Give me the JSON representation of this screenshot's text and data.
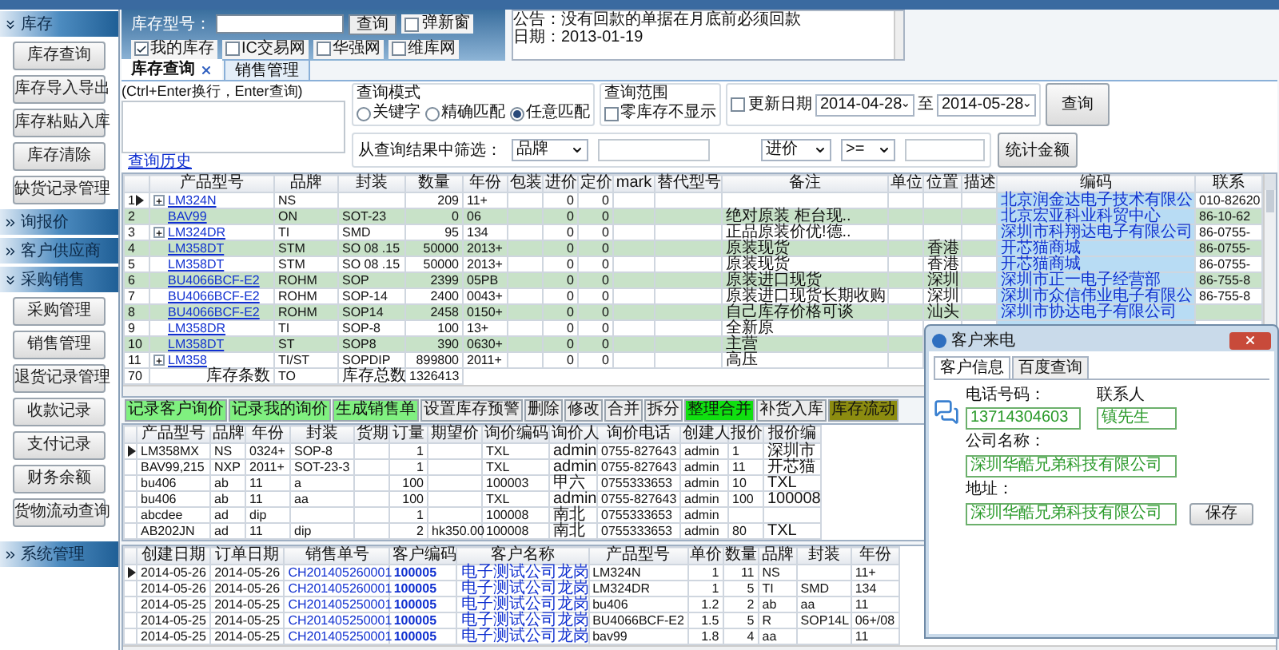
{
  "sidebar": {
    "sections": [
      {
        "label": "库存",
        "expanded": true,
        "items": [
          "库存查询",
          "库存导入导出",
          "库存粘贴入库",
          "库存清除",
          "缺货记录管理"
        ]
      },
      {
        "label": "询报价",
        "expanded": false
      },
      {
        "label": "客户供应商",
        "expanded": false
      },
      {
        "label": "采购销售",
        "expanded": true,
        "items": [
          "采购管理",
          "销售管理",
          "退货记录管理",
          "收款记录",
          "支付记录",
          "财务余额",
          "货物流动查询"
        ]
      },
      {
        "label": "系统管理",
        "expanded": false
      }
    ]
  },
  "header": {
    "model_label": "库存型号：",
    "search_button": "查询",
    "popup": {
      "label": "弹新窗",
      "checked": false
    },
    "sources": [
      {
        "label": "我的库存",
        "checked": true
      },
      {
        "label": "IC交易网",
        "checked": false
      },
      {
        "label": "华强网",
        "checked": false
      },
      {
        "label": "维库网",
        "checked": false
      }
    ],
    "notice": [
      "公告：没有回款的单据在月底前必须回款",
      "日期：2013-01-19"
    ]
  },
  "tabs": [
    {
      "label": "库存查询",
      "selected": true,
      "closable": true
    },
    {
      "label": "销售管理",
      "selected": false,
      "closable": false
    }
  ],
  "query": {
    "hint": "(Ctrl+Enter换行，Enter查询)",
    "history_link": "查询历史",
    "mode": {
      "title": "查询模式",
      "options": [
        {
          "label": "关键字",
          "selected": false
        },
        {
          "label": "精确匹配",
          "selected": false
        },
        {
          "label": "任意匹配",
          "selected": true
        }
      ]
    },
    "range": {
      "title": "查询范围",
      "hide_zero": {
        "label": "零库存不显示",
        "checked": false
      }
    },
    "date_filter": {
      "label": "更新日期",
      "checked": false,
      "from": "2014-04-28",
      "to_label": "至",
      "to": "2014-05-28"
    },
    "search_button": "查询",
    "filter": {
      "label": "从查询结果中筛选：",
      "field": "品牌",
      "price_field": "进价",
      "operator": ">="
    },
    "sum_button": "统计金额"
  },
  "stock_table": {
    "columns": [
      "产品型号",
      "品牌",
      "封装",
      "数量",
      "年份",
      "包装",
      "进价",
      "定价",
      "mark",
      "替代型号",
      "备注",
      "单位",
      "位置",
      "描述",
      "编码",
      "联系"
    ],
    "rows": [
      {
        "num": "1",
        "current": true,
        "expandable": true,
        "highlighted": false,
        "cells": [
          "LM324N",
          "NS",
          null,
          "209",
          "11+",
          null,
          "0",
          "0",
          null,
          null,
          null,
          null,
          null,
          null,
          "北京润金达电子技术有限公",
          "010-82620"
        ]
      },
      {
        "num": "2",
        "current": false,
        "expandable": false,
        "highlighted": true,
        "cells": [
          "BAV99",
          "ON",
          "SOT-23",
          "0",
          "06",
          null,
          "0",
          "0",
          null,
          null,
          "绝对原装 柜台现..",
          null,
          null,
          null,
          "北京宏亚科业科贸中心",
          "86-10-62"
        ]
      },
      {
        "num": "3",
        "current": false,
        "expandable": true,
        "highlighted": false,
        "cells": [
          "LM324DR",
          "TI",
          "SMD",
          "95",
          "134",
          null,
          "0",
          "0",
          null,
          null,
          "正品原装价优!德..",
          null,
          null,
          null,
          "深圳市科翔达电子有限公司",
          "86-0755-"
        ]
      },
      {
        "num": "4",
        "current": false,
        "expandable": false,
        "highlighted": true,
        "cells": [
          "LM358DT",
          "STM",
          "SO 08 .15",
          "50000",
          "2013+",
          null,
          "0",
          "0",
          null,
          null,
          "原装现货",
          null,
          "香港",
          null,
          "开芯猫商城",
          "86-0755-"
        ]
      },
      {
        "num": "5",
        "current": false,
        "expandable": false,
        "highlighted": false,
        "cells": [
          "LM358DT",
          "STM",
          "SO 08 .15",
          "50000",
          "2013+",
          null,
          "0",
          "0",
          null,
          null,
          "原装现货",
          null,
          "香港",
          null,
          "开芯猫商城",
          "86-0755-"
        ]
      },
      {
        "num": "6",
        "current": false,
        "expandable": false,
        "highlighted": true,
        "cells": [
          "BU4066BCF-E2",
          "ROHM",
          "SOP",
          "2399",
          "05PB",
          null,
          "0",
          "0",
          null,
          null,
          "原装进口现货",
          null,
          "深圳",
          null,
          "深圳市正一电子经营部",
          "86-755-8"
        ]
      },
      {
        "num": "7",
        "current": false,
        "expandable": false,
        "highlighted": false,
        "cells": [
          "BU4066BCF-E2",
          "ROHM",
          "SOP-14",
          "2400",
          "0043+",
          null,
          "0",
          "0",
          null,
          null,
          "原装进口现货长期收购",
          null,
          "深圳",
          null,
          "深圳市众信伟业电子有限公",
          "86-755-8"
        ]
      },
      {
        "num": "8",
        "current": false,
        "expandable": false,
        "highlighted": true,
        "cells": [
          "BU4066BCF-E2",
          "ROHM",
          "SOP14",
          "2458",
          "0150+",
          null,
          "0",
          "0",
          null,
          null,
          "自己库存价格可谈",
          null,
          "汕头",
          null,
          "深圳市协达电子有限公司",
          null
        ]
      },
      {
        "num": "9",
        "current": false,
        "expandable": false,
        "highlighted": false,
        "cells": [
          "LM358DR",
          "TI",
          "SOP-8",
          "100",
          "13+",
          null,
          "0",
          "0",
          null,
          null,
          "全新原",
          null,
          null,
          null,
          null,
          null
        ]
      },
      {
        "num": "10",
        "current": false,
        "expandable": false,
        "highlighted": true,
        "cells": [
          "LM358DT",
          "ST",
          "SOP8",
          "390",
          "0630+",
          null,
          "0",
          "0",
          null,
          null,
          "主营",
          null,
          null,
          null,
          null,
          null
        ]
      },
      {
        "num": "11",
        "current": false,
        "expandable": true,
        "highlighted": false,
        "cells": [
          "LM358",
          "TI/ST",
          "SOPDIP",
          "899800",
          "2011+",
          null,
          "0",
          "0",
          null,
          null,
          "高压",
          null,
          null,
          null,
          null,
          null
        ]
      }
    ],
    "footer": {
      "count": "70",
      "count_label": "库存条数",
      "brand": "TO",
      "total_label": "库存总数",
      "total": "1326413"
    }
  },
  "actions": [
    {
      "label": "记录客户询价",
      "color": "#80f080"
    },
    {
      "label": "记录我的询价",
      "color": "#80f080"
    },
    {
      "label": "生成销售单",
      "color": "#80f080"
    },
    {
      "label": "设置库存预警",
      "color": "#ececec"
    },
    {
      "label": "删除",
      "color": "#ececec"
    },
    {
      "label": "修改",
      "color": "#ececec"
    },
    {
      "label": "合并",
      "color": "#ececec"
    },
    {
      "label": "拆分",
      "color": "#ececec"
    },
    {
      "label": "整理合并",
      "color": "#10e010"
    },
    {
      "label": "补货入库",
      "color": "#ececec"
    },
    {
      "label": "库存流动",
      "color": "#8c8c10"
    }
  ],
  "inquiry_table": {
    "columns": [
      "产品型号",
      "品牌",
      "年份",
      "封装",
      "货期",
      "订量",
      "期望价",
      "询价编码",
      "询价人",
      "询价电话",
      "创建人",
      "报价",
      "报价编"
    ],
    "rows": [
      {
        "current": true,
        "cells": [
          "LM358MX",
          "NS",
          "0324+",
          "SOP-8",
          null,
          "1",
          null,
          "TXL",
          "admin",
          "0755-827643",
          "admin",
          "1",
          "深圳市"
        ]
      },
      {
        "current": false,
        "cells": [
          "BAV99,215",
          "NXP",
          "2011+",
          "SOT-23-3",
          null,
          "1",
          null,
          "TXL",
          "admin",
          "0755-827643",
          "admin",
          "11",
          "开芯猫"
        ]
      },
      {
        "current": false,
        "cells": [
          "bu406",
          "ab",
          "11",
          "a",
          null,
          "100",
          null,
          "100003",
          "甲六",
          "0755333653",
          "admin",
          "10",
          "TXL"
        ]
      },
      {
        "current": false,
        "cells": [
          "bu406",
          "ab",
          "11",
          "aa",
          null,
          "100",
          null,
          "TXL",
          "admin",
          "0755-827643",
          "admin",
          "100",
          "100008"
        ]
      },
      {
        "current": false,
        "cells": [
          "abcdee",
          "ad",
          "dip",
          null,
          null,
          "1",
          null,
          "100008",
          "南北",
          "0755333653",
          "admin",
          null,
          null
        ]
      },
      {
        "current": false,
        "cells": [
          "AB202JN",
          "ad",
          "11",
          "dip",
          null,
          "2",
          "hk350.00",
          "100008",
          "南北",
          "0755333653",
          "admin",
          "80",
          "TXL"
        ]
      }
    ]
  },
  "sales_table": {
    "columns": [
      "创建日期",
      "订单日期",
      "销售单号",
      "客户编码",
      "客户名称",
      "产品型号",
      "单价",
      "数量",
      "品牌",
      "封装",
      "年份"
    ],
    "rows": [
      {
        "current": true,
        "cells": [
          "2014-05-26",
          "2014-05-26",
          "CH201405260001",
          "100005",
          "电子测试公司龙岗",
          "LM324N",
          "1",
          "11",
          "NS",
          null,
          "11+"
        ]
      },
      {
        "current": false,
        "cells": [
          "2014-05-26",
          "2014-05-26",
          "CH201405260001",
          "100005",
          "电子测试公司龙岗",
          "LM324DR",
          "1",
          "5",
          "TI",
          "SMD",
          "134"
        ]
      },
      {
        "current": false,
        "cells": [
          "2014-05-25",
          "2014-05-25",
          "CH201405250001",
          "100005",
          "电子测试公司龙岗",
          "bu406",
          "1.2",
          "2",
          "ab",
          "aa",
          "11"
        ]
      },
      {
        "current": false,
        "cells": [
          "2014-05-25",
          "2014-05-25",
          "CH201405250001",
          "100005",
          "电子测试公司龙岗",
          "BU4066BCF-E2",
          "1.5",
          "5",
          "R",
          "SOP14L",
          "06+/08"
        ]
      },
      {
        "current": false,
        "cells": [
          "2014-05-25",
          "2014-05-25",
          "CH201405250001",
          "100005",
          "电子测试公司龙岗",
          "bav99",
          "1.8",
          "4",
          "aa",
          null,
          "11"
        ]
      }
    ]
  },
  "dialog": {
    "title": "客户来电",
    "tabs": [
      {
        "label": "客户信息",
        "selected": true
      },
      {
        "label": "百度查询",
        "selected": false
      }
    ],
    "phone_label": "电话号码：",
    "phone": "13714304603",
    "contact_label": "联系人",
    "contact": "镇先生",
    "company_label": "公司名称：",
    "company": "深圳华酷兄弟科技有限公司",
    "address_label": "地址：",
    "address": "深圳华酷兄弟科技有限公司",
    "save_button": "保存"
  }
}
